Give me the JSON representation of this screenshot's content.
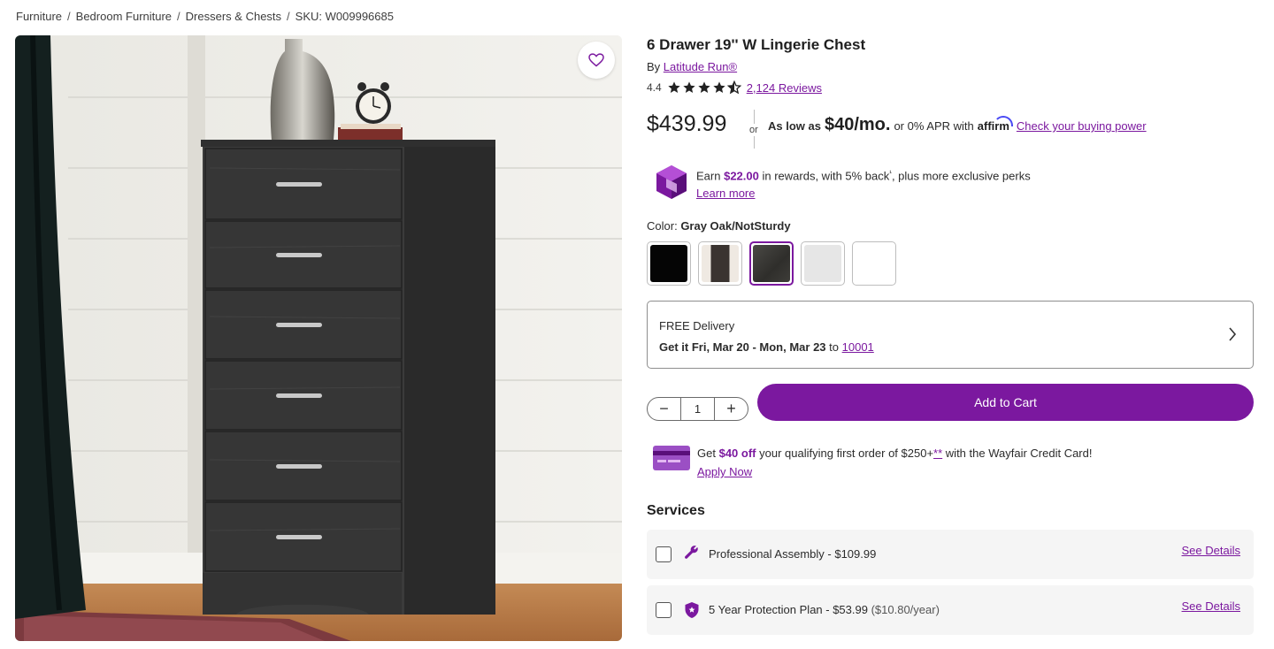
{
  "breadcrumb": {
    "items": [
      "Furniture",
      "Bedroom Furniture",
      "Dressers & Chests"
    ],
    "sku": "SKU: W009996685",
    "separator": "/"
  },
  "product": {
    "title": "6 Drawer 19'' W Lingerie Chest",
    "by_label": "By",
    "brand": "Latitude Run®",
    "rating": "4.4",
    "rating_value": 4.4,
    "reviews": "2,124 Reviews",
    "price": "$439.99"
  },
  "financing": {
    "or": "or",
    "as_low_as": "As low as",
    "monthly": "$40/mo.",
    "apr": "or 0% APR with",
    "affirm": "affirm",
    "cta": "Check your buying power"
  },
  "rewards": {
    "earn": "Earn",
    "amount": "$22.00",
    "rest": "in rewards, with 5% back",
    "sup": "¹",
    "rest2": ", plus more exclusive perks",
    "learn_more": "Learn more"
  },
  "color": {
    "label": "Color:",
    "selected": "Gray Oak/NotSturdy",
    "swatches": [
      {
        "name": "black",
        "color": "#050505"
      },
      {
        "name": "photo",
        "color": "#6b5f55"
      },
      {
        "name": "gray-oak",
        "color": "#3c3b38"
      },
      {
        "name": "light-gray",
        "color": "#e6e6e6"
      },
      {
        "name": "white",
        "color": "#ffffff"
      }
    ],
    "selected_index": 2
  },
  "delivery": {
    "title": "FREE Delivery",
    "get_it": "Get it Fri, Mar 20 - Mon, Mar 23",
    "to": "to",
    "zip": "10001"
  },
  "cart": {
    "quantity": "1",
    "minus": "−",
    "plus": "+",
    "add_label": "Add to Cart"
  },
  "credit": {
    "get": "Get",
    "off": "$40 off",
    "rest": "your qualifying first order of $250+",
    "stars": "**",
    "rest2": "with the Wayfair Credit Card!",
    "apply": "Apply Now"
  },
  "services": {
    "heading": "Services",
    "items": [
      {
        "label": "Professional Assembly - $109.99",
        "extra": "",
        "details": "See Details",
        "icon": "wrench-icon"
      },
      {
        "label": "5 Year Protection Plan - $53.99",
        "extra": "($10.80/year)",
        "details": "See Details",
        "icon": "shield-icon"
      }
    ]
  },
  "colors": {
    "accent": "#7b189f",
    "text": "#2b2b2b"
  }
}
